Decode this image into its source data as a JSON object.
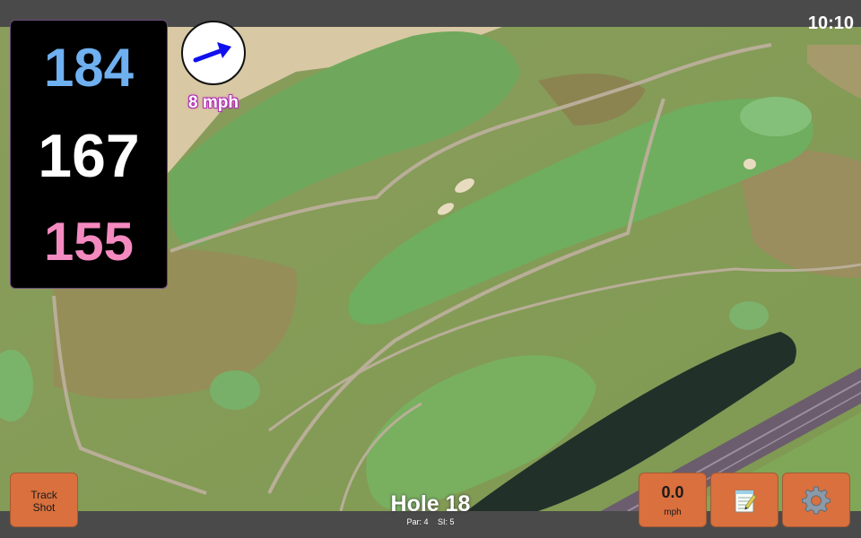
{
  "status": {
    "time": "10:10"
  },
  "distances": {
    "back": "184",
    "middle": "167",
    "front": "155"
  },
  "wind": {
    "speed_label": "8 mph",
    "arrow_icon": "arrow-right-icon",
    "arrow_color": "#1010ee"
  },
  "toolbar": {
    "track_shot_line1": "Track",
    "track_shot_line2": "Shot",
    "speed_value": "0.0",
    "speed_unit": "mph",
    "notes_icon": "notepad-icon",
    "settings_icon": "gear-icon"
  },
  "hole": {
    "title": "Hole 18",
    "par": "Par: 4",
    "si": "SI: 5"
  },
  "colors": {
    "back": "#6fb0f0",
    "middle": "#ffffff",
    "front": "#f48ac0",
    "button": "#d9703e",
    "bar": "#4a4a4a"
  }
}
